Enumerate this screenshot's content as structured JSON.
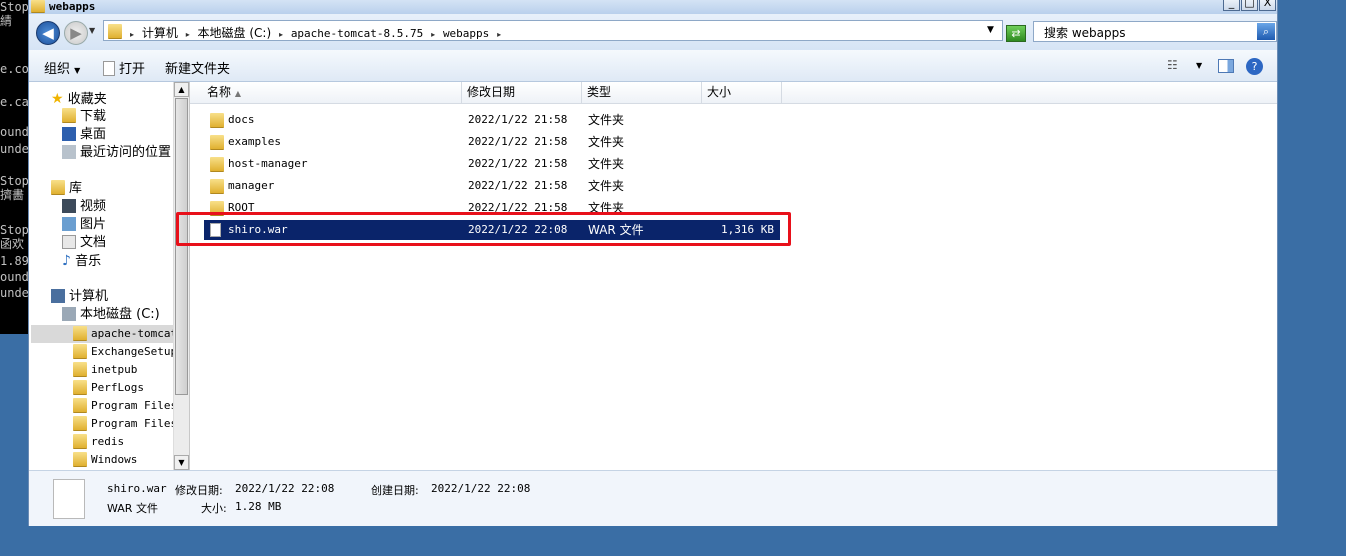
{
  "console": {
    "lines": [
      "Stop",
      "  綪",
      "e.co",
      "e.ca",
      "ound",
      "unde",
      "Stop",
      "擠畵",
      "Stop",
      "函欢",
      "1.89",
      "ound",
      "unde"
    ]
  },
  "window": {
    "title": "webapps",
    "caption_buttons": {
      "minimize": "_",
      "maximize": "□",
      "close": "X"
    }
  },
  "address": {
    "crumbs": [
      "计算机",
      "本地磁盘 (C:)",
      "apache-tomcat-8.5.75",
      "webapps"
    ],
    "search_placeholder": "搜索 webapps"
  },
  "toolbar": {
    "organize": "组织",
    "open": "打开",
    "new_folder": "新建文件夹"
  },
  "nav": {
    "favorites": "收藏夹",
    "downloads": "下载",
    "desktop": "桌面",
    "recent": "最近访问的位置",
    "libraries": "库",
    "videos": "视频",
    "pictures": "图片",
    "documents": "文档",
    "music": "音乐",
    "computer": "计算机",
    "local_disk": "本地磁盘 (C:)",
    "folders": [
      "apache-tomcat-",
      "ExchangeSetupL",
      "inetpub",
      "PerfLogs",
      "Program Files",
      "Program Files",
      "redis",
      "Windows"
    ]
  },
  "columns": {
    "name": "名称",
    "date": "修改日期",
    "type": "类型",
    "size": "大小"
  },
  "files": [
    {
      "name": "docs",
      "date": "2022/1/22 21:58",
      "type": "文件夹",
      "size": ""
    },
    {
      "name": "examples",
      "date": "2022/1/22 21:58",
      "type": "文件夹",
      "size": ""
    },
    {
      "name": "host-manager",
      "date": "2022/1/22 21:58",
      "type": "文件夹",
      "size": ""
    },
    {
      "name": "manager",
      "date": "2022/1/22 21:58",
      "type": "文件夹",
      "size": ""
    },
    {
      "name": "ROOT",
      "date": "2022/1/22 21:58",
      "type": "文件夹",
      "size": ""
    },
    {
      "name": "shiro.war",
      "date": "2022/1/22 22:08",
      "type": "WAR 文件",
      "size": "1,316 KB"
    }
  ],
  "details": {
    "filename": "shiro.war",
    "modified_label": "修改日期:",
    "modified": "2022/1/22 22:08",
    "created_label": "创建日期:",
    "created": "2022/1/22 22:08",
    "type": "WAR 文件",
    "size_label": "大小:",
    "size": "1.28 MB"
  }
}
